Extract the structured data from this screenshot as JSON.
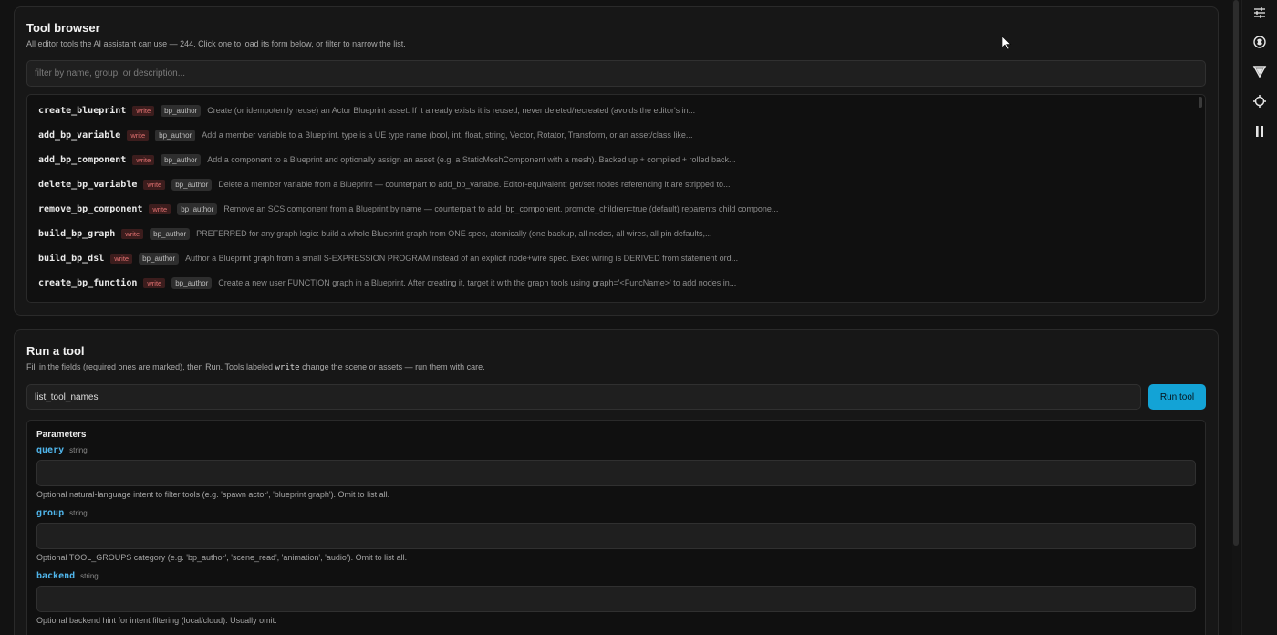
{
  "browser": {
    "title": "Tool browser",
    "subtitle": "All editor tools the AI assistant can use — 244. Click one to load its form below, or filter to narrow the list.",
    "filter_placeholder": "filter by name, group, or description...",
    "tools": [
      {
        "name": "create_blueprint",
        "badge": "write",
        "group": "bp_author",
        "desc": "Create (or idempotently reuse) an Actor Blueprint asset. If it already exists it is reused, never deleted/recreated (avoids the editor's in..."
      },
      {
        "name": "add_bp_variable",
        "badge": "write",
        "group": "bp_author",
        "desc": "Add a member variable to a Blueprint. type is a UE type name (bool, int, float, string, Vector, Rotator, Transform, or an asset/class like..."
      },
      {
        "name": "add_bp_component",
        "badge": "write",
        "group": "bp_author",
        "desc": "Add a component to a Blueprint and optionally assign an asset (e.g. a StaticMeshComponent with a mesh). Backed up + compiled + rolled back..."
      },
      {
        "name": "delete_bp_variable",
        "badge": "write",
        "group": "bp_author",
        "desc": "Delete a member variable from a Blueprint — counterpart to add_bp_variable. Editor-equivalent: get/set nodes referencing it are stripped to..."
      },
      {
        "name": "remove_bp_component",
        "badge": "write",
        "group": "bp_author",
        "desc": "Remove an SCS component from a Blueprint by name — counterpart to add_bp_component. promote_children=true (default) reparents child compone..."
      },
      {
        "name": "build_bp_graph",
        "badge": "write",
        "group": "bp_author",
        "desc": "PREFERRED for any graph logic: build a whole Blueprint graph from ONE spec, atomically (one backup, all nodes, all wires, all pin defaults,..."
      },
      {
        "name": "build_bp_dsl",
        "badge": "write",
        "group": "bp_author",
        "desc": "Author a Blueprint graph from a small S-EXPRESSION PROGRAM instead of an explicit node+wire spec. Exec wiring is DERIVED from statement ord..."
      },
      {
        "name": "create_bp_function",
        "badge": "write",
        "group": "bp_author",
        "desc": "Create a new user FUNCTION graph in a Blueprint. After creating it, target it with the graph tools using graph='<FuncName>' to add nodes in..."
      }
    ]
  },
  "run": {
    "title": "Run a tool",
    "subtitle_before": "Fill in the fields (required ones are marked), then Run. Tools labeled ",
    "subtitle_code": "write",
    "subtitle_after": " change the scene or assets — run them with care.",
    "tool_value": "list_tool_names",
    "run_label": "Run tool",
    "params_title": "Parameters",
    "params": [
      {
        "name": "query",
        "type": "string",
        "desc": "Optional natural-language intent to filter tools (e.g. 'spawn actor', 'blueprint graph'). Omit to list all."
      },
      {
        "name": "group",
        "type": "string",
        "desc": "Optional TOOL_GROUPS category (e.g. 'bp_author', 'scene_read', 'animation', 'audio'). Omit to list all."
      },
      {
        "name": "backend",
        "type": "string",
        "desc": "Optional backend hint for intent filtering (local/cloud). Usually omit."
      }
    ]
  },
  "icons": {
    "rail": [
      "sliders-icon",
      "brain-icon",
      "triangle-logo-icon",
      "target-icon",
      "pause-icon"
    ]
  },
  "colors": {
    "accent": "#13a3d6",
    "write_badge": "#e07070",
    "param_name": "#4fb3e8"
  }
}
